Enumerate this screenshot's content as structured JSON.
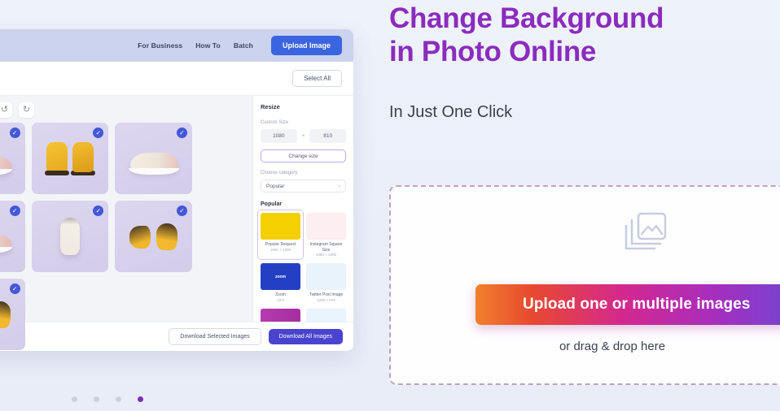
{
  "hero": {
    "title_line1": "Change Background",
    "title_line2": "in Photo Online",
    "subtitle": "In Just One Click",
    "title_color": "#8b2cbd"
  },
  "dropzone": {
    "icon_name": "stacked-images-icon",
    "upload_button_label": "Upload one or multiple images",
    "drag_hint": "or drag & drop here",
    "border_color": "#c49fc4",
    "gradient_from": "#f0812d",
    "gradient_mid": "#d4288f",
    "gradient_to": "#5e4fd6"
  },
  "mockup": {
    "nav": {
      "links": [
        {
          "label": "For Business"
        },
        {
          "label": "How To"
        },
        {
          "label": "Batch"
        }
      ],
      "upload_button_label": "Upload Image",
      "upload_button_color": "#3b64e0"
    },
    "toolbar": {
      "select_all_label": "Select All"
    },
    "canvas": {
      "undo_icon": "↺",
      "redo_icon": "↻",
      "check_icon": "✓",
      "photos": [
        {
          "alt": "sneaker-rose-side",
          "shape": "shoe-sneaker-a",
          "selected": true
        },
        {
          "alt": "yellow-boots-pair",
          "shape": "shoe-boot",
          "selected": true
        },
        {
          "alt": "cream-sneaker-side",
          "shape": "shoe-sneaker-b",
          "selected": true
        },
        {
          "alt": "rose-sneaker-angle",
          "shape": "shoe-sneaker-a",
          "selected": true
        },
        {
          "alt": "white-sneaker-top",
          "shape": "shoe-top",
          "selected": true
        },
        {
          "alt": "boots-top-pair",
          "shape": "shoe-pair",
          "selected": true
        },
        {
          "alt": "boot-partial",
          "shape": "shoe-pair",
          "selected": true
        }
      ]
    },
    "sidebar": {
      "title": "Resize",
      "custom_size_label": "Custom Size",
      "width_value": "1080",
      "height_value": "810",
      "separator": "×",
      "change_size_label": "Change size",
      "choose_category_label": "Choose category",
      "category_value": "Popular",
      "chevron_icon": "›",
      "popular_title": "Popular",
      "presets": [
        {
          "name": "Popular Request",
          "dim": "1920 × 1080",
          "thumb_class": "pt-yellow",
          "thumb_text": "",
          "selected": true
        },
        {
          "name": "Instagram Square Size",
          "dim": "1080 × 1080",
          "thumb_class": "pt-pink",
          "thumb_text": "",
          "selected": false
        },
        {
          "name": "Zoom",
          "dim": "16:9",
          "thumb_class": "pt-blue",
          "thumb_text": "zoom",
          "selected": false
        },
        {
          "name": "Twitter Post Image",
          "dim": "1200 × 675",
          "thumb_class": "pt-sky",
          "thumb_text": "",
          "selected": false
        },
        {
          "name": "",
          "dim": "",
          "thumb_class": "pt-magenta",
          "thumb_text": "",
          "selected": false
        },
        {
          "name": "",
          "dim": "",
          "thumb_class": "pt-ice",
          "thumb_text": "",
          "selected": false
        }
      ]
    },
    "footer": {
      "download_selected_label": "Download Selected Images",
      "download_all_label": "Download All Images",
      "download_all_color": "#4a43cf"
    }
  },
  "carousel": {
    "dots": [
      {
        "active": false
      },
      {
        "active": false
      },
      {
        "active": false
      },
      {
        "active": true
      }
    ],
    "active_color": "#7b2fb8"
  }
}
